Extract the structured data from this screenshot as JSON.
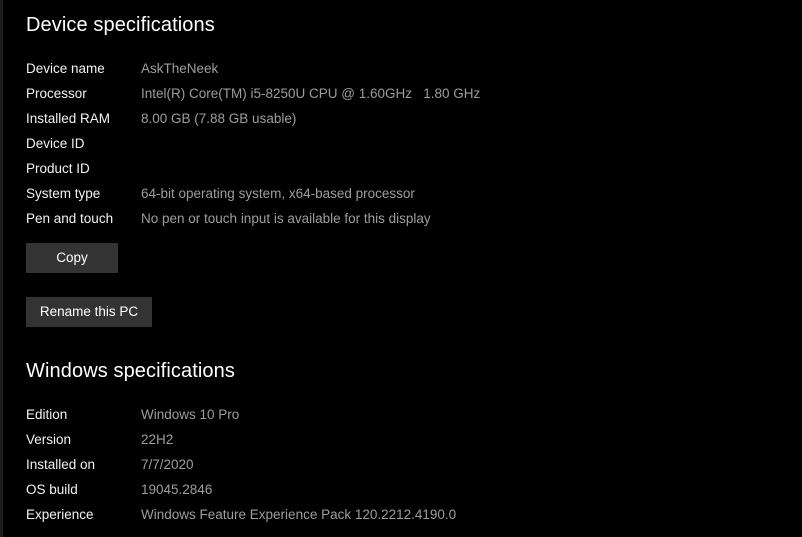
{
  "device_section": {
    "heading": "Device specifications",
    "rows": [
      {
        "label": "Device name",
        "value": "AskTheNeek"
      },
      {
        "label": "Processor",
        "value": "Intel(R) Core(TM) i5-8250U CPU @ 1.60GHz   1.80 GHz"
      },
      {
        "label": "Installed RAM",
        "value": "8.00 GB (7.88 GB usable)"
      },
      {
        "label": "Device ID",
        "value": ""
      },
      {
        "label": "Product ID",
        "value": ""
      },
      {
        "label": "System type",
        "value": "64-bit operating system, x64-based processor"
      },
      {
        "label": "Pen and touch",
        "value": "No pen or touch input is available for this display"
      }
    ],
    "copy_button": "Copy",
    "rename_button": "Rename this PC"
  },
  "windows_section": {
    "heading": "Windows specifications",
    "rows": [
      {
        "label": "Edition",
        "value": "Windows 10 Pro"
      },
      {
        "label": "Version",
        "value": "22H2"
      },
      {
        "label": "Installed on",
        "value": "7/7/2020"
      },
      {
        "label": "OS build",
        "value": "19045.2846"
      },
      {
        "label": "Experience",
        "value": "Windows Feature Experience Pack 120.2212.4190.0"
      }
    ]
  },
  "colors": {
    "background": "#000000",
    "label_text": "#f2f2f2",
    "value_text": "#9d9d9d",
    "button_background": "#333333"
  }
}
